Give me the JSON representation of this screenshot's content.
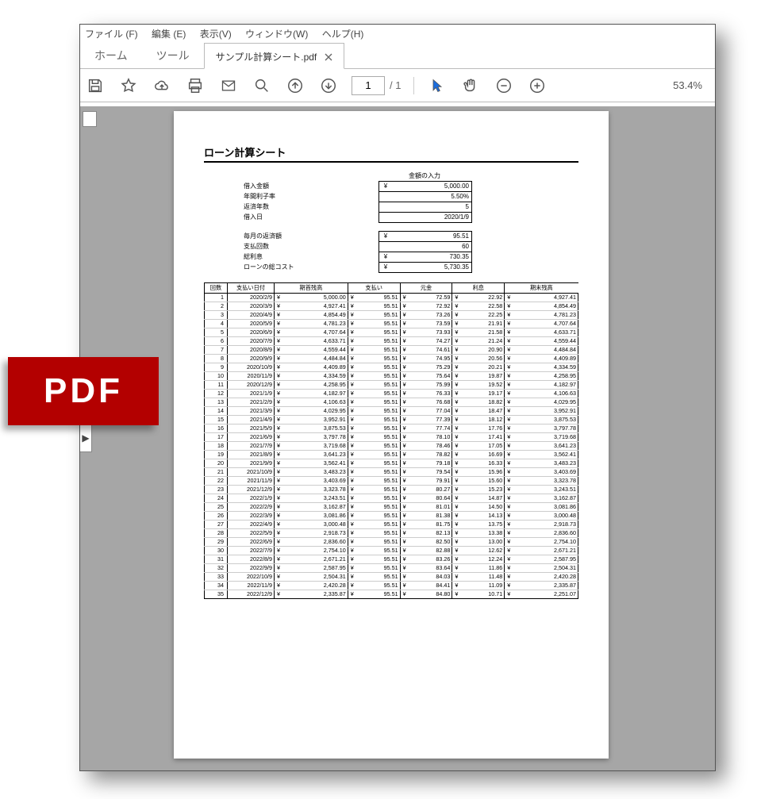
{
  "menubar": {
    "file": "ファイル (F)",
    "edit": "編集 (E)",
    "view": "表示(V)",
    "window": "ウィンドウ(W)",
    "help": "ヘルプ(H)"
  },
  "tabs": {
    "home": "ホーム",
    "tools": "ツール",
    "active": "サンプル計算シート.pdf"
  },
  "toolbar": {
    "page": "1",
    "total": "/ 1",
    "zoom": "53.4%"
  },
  "badge": "PDF",
  "doc": {
    "title": "ローン計算シート",
    "input_caption": "金額の入力",
    "params": [
      {
        "label": "借入金額",
        "cur": "¥",
        "val": "5,000.00"
      },
      {
        "label": "年間利子率",
        "cur": "",
        "val": "5.50%"
      },
      {
        "label": "返済年数",
        "cur": "",
        "val": "5"
      },
      {
        "label": "借入日",
        "cur": "",
        "val": "2020/1/9"
      }
    ],
    "summary": [
      {
        "label": "毎月の返済額",
        "cur": "¥",
        "val": "95.51"
      },
      {
        "label": "支払回数",
        "cur": "",
        "val": "60"
      },
      {
        "label": "総利息",
        "cur": "¥",
        "val": "730.35"
      },
      {
        "label": "ローンの総コスト",
        "cur": "¥",
        "val": "5,730.35"
      }
    ],
    "headers": [
      "回数",
      "支払い日付",
      "期首残高",
      "支払い",
      "元金",
      "利息",
      "期末残高"
    ],
    "cur": "¥"
  },
  "chart_data": {
    "type": "table",
    "columns": [
      "回数",
      "支払い日付",
      "期首残高",
      "支払い",
      "元金",
      "利息",
      "期末残高"
    ],
    "rows": [
      [
        1,
        "2020/2/9",
        "5,000.00",
        "95.51",
        "72.59",
        "22.92",
        "4,927.41"
      ],
      [
        2,
        "2020/3/9",
        "4,927.41",
        "95.51",
        "72.92",
        "22.58",
        "4,854.49"
      ],
      [
        3,
        "2020/4/9",
        "4,854.49",
        "95.51",
        "73.26",
        "22.25",
        "4,781.23"
      ],
      [
        4,
        "2020/5/9",
        "4,781.23",
        "95.51",
        "73.59",
        "21.91",
        "4,707.64"
      ],
      [
        5,
        "2020/6/9",
        "4,707.64",
        "95.51",
        "73.93",
        "21.58",
        "4,633.71"
      ],
      [
        6,
        "2020/7/9",
        "4,633.71",
        "95.51",
        "74.27",
        "21.24",
        "4,559.44"
      ],
      [
        7,
        "2020/8/9",
        "4,559.44",
        "95.51",
        "74.61",
        "20.90",
        "4,484.84"
      ],
      [
        8,
        "2020/9/9",
        "4,484.84",
        "95.51",
        "74.95",
        "20.56",
        "4,409.89"
      ],
      [
        9,
        "2020/10/9",
        "4,409.89",
        "95.51",
        "75.29",
        "20.21",
        "4,334.59"
      ],
      [
        10,
        "2020/11/9",
        "4,334.59",
        "95.51",
        "75.64",
        "19.87",
        "4,258.95"
      ],
      [
        11,
        "2020/12/9",
        "4,258.95",
        "95.51",
        "75.99",
        "19.52",
        "4,182.97"
      ],
      [
        12,
        "2021/1/9",
        "4,182.97",
        "95.51",
        "76.33",
        "19.17",
        "4,106.63"
      ],
      [
        13,
        "2021/2/9",
        "4,106.63",
        "95.51",
        "76.68",
        "18.82",
        "4,029.95"
      ],
      [
        14,
        "2021/3/9",
        "4,029.95",
        "95.51",
        "77.04",
        "18.47",
        "3,952.91"
      ],
      [
        15,
        "2021/4/9",
        "3,952.91",
        "95.51",
        "77.39",
        "18.12",
        "3,875.53"
      ],
      [
        16,
        "2021/5/9",
        "3,875.53",
        "95.51",
        "77.74",
        "17.76",
        "3,797.78"
      ],
      [
        17,
        "2021/6/9",
        "3,797.78",
        "95.51",
        "78.10",
        "17.41",
        "3,719.68"
      ],
      [
        18,
        "2021/7/9",
        "3,719.68",
        "95.51",
        "78.46",
        "17.05",
        "3,641.23"
      ],
      [
        19,
        "2021/8/9",
        "3,641.23",
        "95.51",
        "78.82",
        "16.69",
        "3,562.41"
      ],
      [
        20,
        "2021/9/9",
        "3,562.41",
        "95.51",
        "79.18",
        "16.33",
        "3,483.23"
      ],
      [
        21,
        "2021/10/9",
        "3,483.23",
        "95.51",
        "79.54",
        "15.96",
        "3,403.69"
      ],
      [
        22,
        "2021/11/9",
        "3,403.69",
        "95.51",
        "79.91",
        "15.60",
        "3,323.78"
      ],
      [
        23,
        "2021/12/9",
        "3,323.78",
        "95.51",
        "80.27",
        "15.23",
        "3,243.51"
      ],
      [
        24,
        "2022/1/9",
        "3,243.51",
        "95.51",
        "80.64",
        "14.87",
        "3,162.87"
      ],
      [
        25,
        "2022/2/9",
        "3,162.87",
        "95.51",
        "81.01",
        "14.50",
        "3,081.86"
      ],
      [
        26,
        "2022/3/9",
        "3,081.86",
        "95.51",
        "81.38",
        "14.13",
        "3,000.48"
      ],
      [
        27,
        "2022/4/9",
        "3,000.48",
        "95.51",
        "81.75",
        "13.75",
        "2,918.73"
      ],
      [
        28,
        "2022/5/9",
        "2,918.73",
        "95.51",
        "82.13",
        "13.38",
        "2,836.60"
      ],
      [
        29,
        "2022/6/9",
        "2,836.60",
        "95.51",
        "82.50",
        "13.00",
        "2,754.10"
      ],
      [
        30,
        "2022/7/9",
        "2,754.10",
        "95.51",
        "82.88",
        "12.62",
        "2,671.21"
      ],
      [
        31,
        "2022/8/9",
        "2,671.21",
        "95.51",
        "83.26",
        "12.24",
        "2,587.95"
      ],
      [
        32,
        "2022/9/9",
        "2,587.95",
        "95.51",
        "83.64",
        "11.86",
        "2,504.31"
      ],
      [
        33,
        "2022/10/9",
        "2,504.31",
        "95.51",
        "84.03",
        "11.48",
        "2,420.28"
      ],
      [
        34,
        "2022/11/9",
        "2,420.28",
        "95.51",
        "84.41",
        "11.09",
        "2,335.87"
      ],
      [
        35,
        "2022/12/9",
        "2,335.87",
        "95.51",
        "84.80",
        "10.71",
        "2,251.07"
      ]
    ]
  }
}
